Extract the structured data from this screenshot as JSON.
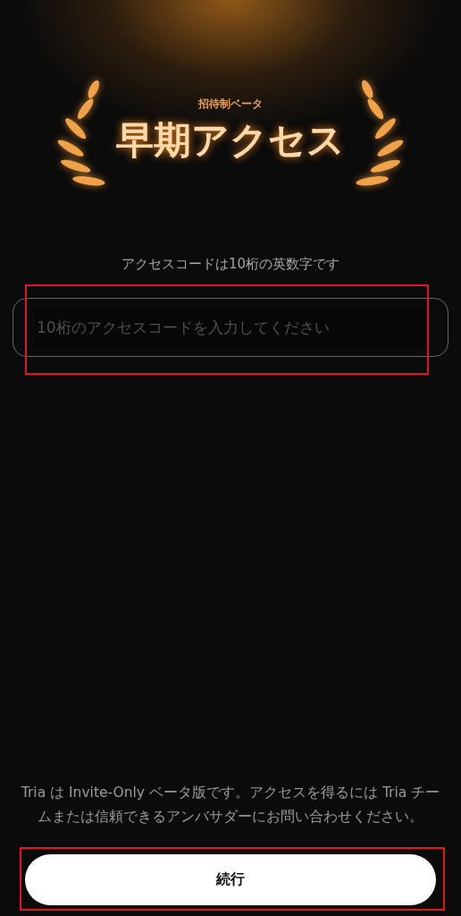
{
  "header": {
    "badge": "招待制ベータ",
    "title": "早期アクセス"
  },
  "instruction": "アクセスコードは10桁の英数字です",
  "code_field": {
    "placeholder": "10桁のアクセスコードを入力してください",
    "highlighted": true
  },
  "notice": "Tria は Invite-Only ベータ版です。アクセスを得るには Tria チームまたは信頼できるアンバサダーにお問い合わせください。",
  "continue_button": {
    "label": "続行",
    "highlighted": true
  }
}
